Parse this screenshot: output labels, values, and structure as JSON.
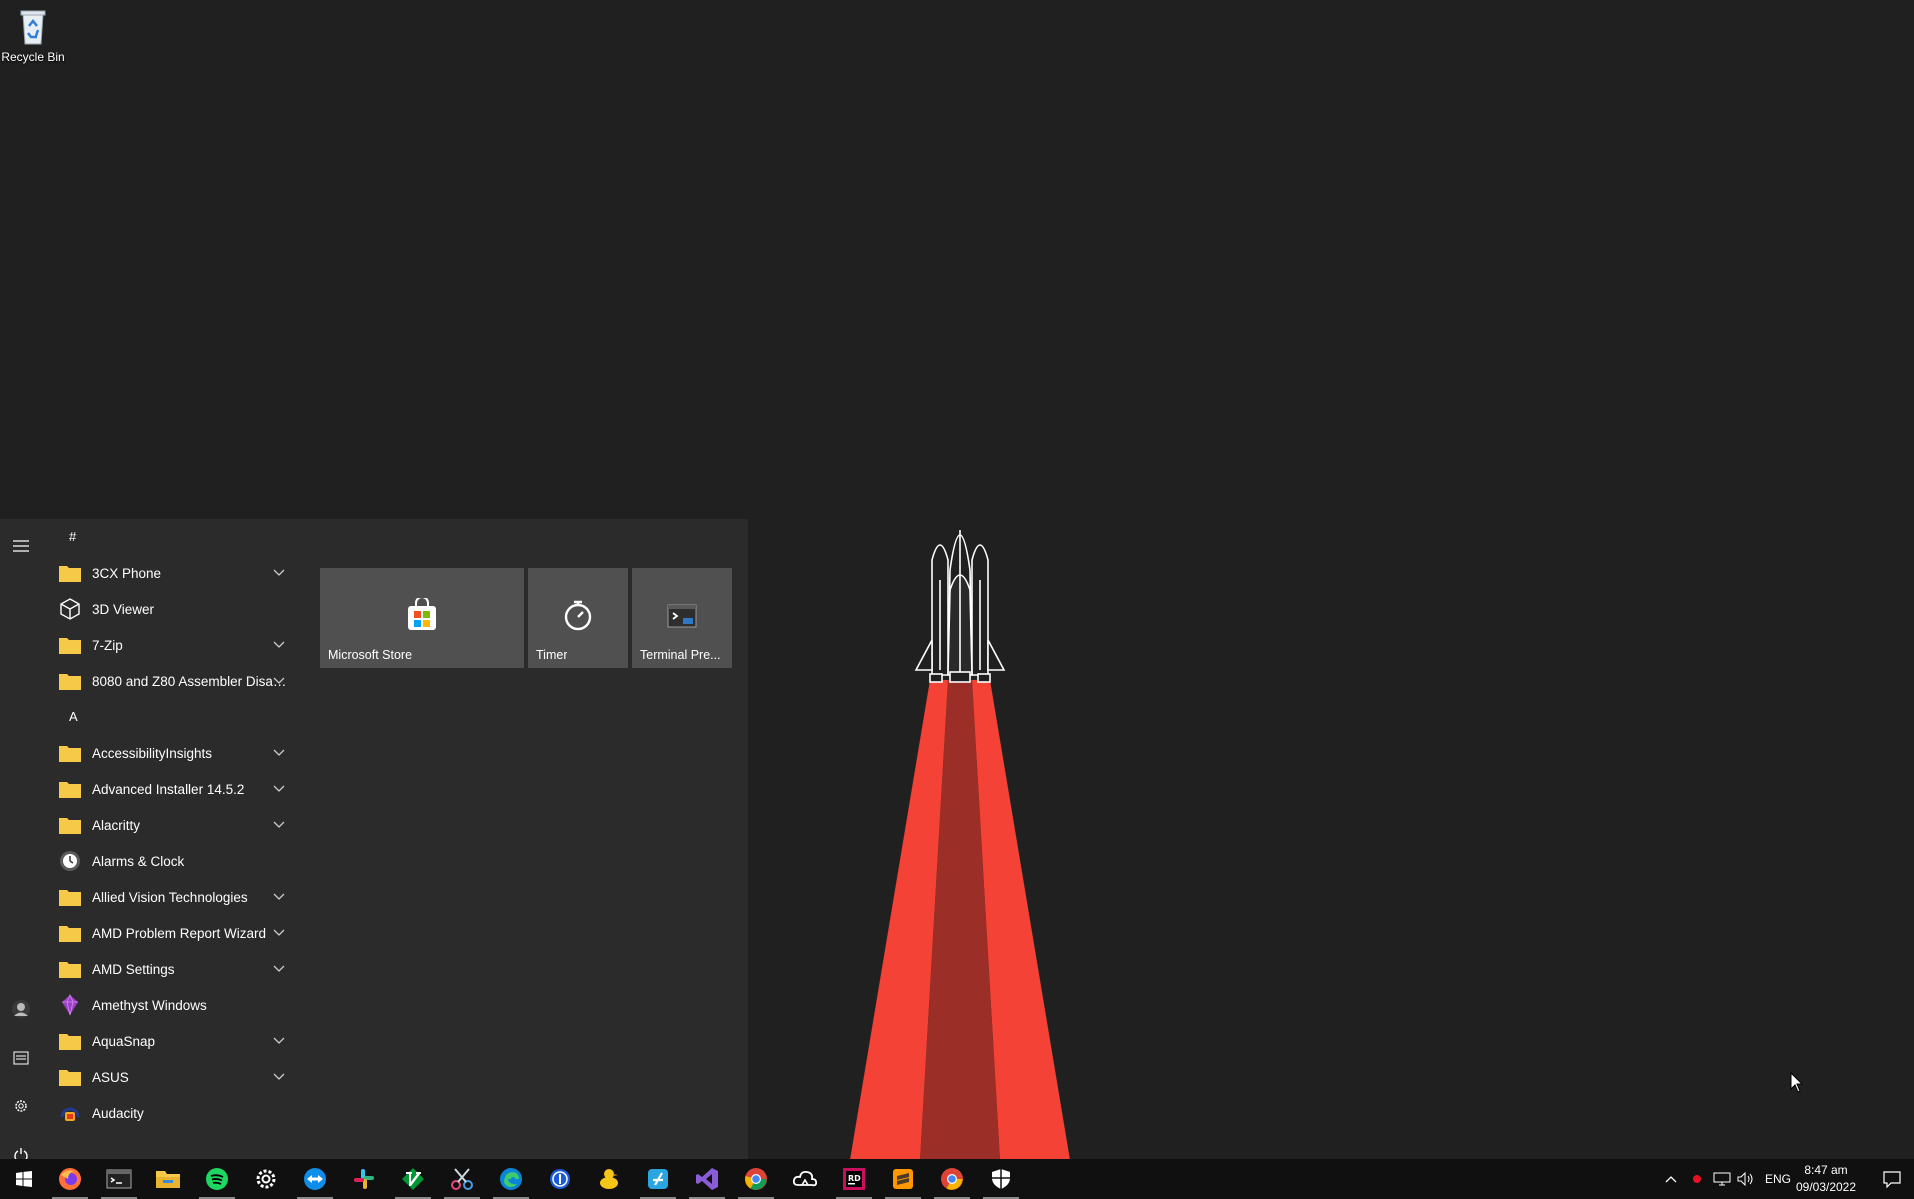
{
  "desktop": {
    "recycle_bin_label": "Recycle Bin"
  },
  "start_menu": {
    "groups": [
      {
        "letter": "#",
        "apps": [
          {
            "name": "3CX Phone",
            "icon": "folder-icon",
            "expandable": true
          },
          {
            "name": "3D Viewer",
            "icon": "cube-icon",
            "expandable": false
          },
          {
            "name": "7-Zip",
            "icon": "folder-icon",
            "expandable": true
          },
          {
            "name": "8080 and Z80 Assembler Disas...",
            "icon": "folder-icon",
            "expandable": true
          }
        ]
      },
      {
        "letter": "A",
        "apps": [
          {
            "name": "AccessibilityInsights",
            "icon": "folder-icon",
            "expandable": true
          },
          {
            "name": "Advanced Installer 14.5.2",
            "icon": "folder-icon",
            "expandable": true
          },
          {
            "name": "Alacritty",
            "icon": "folder-icon",
            "expandable": true
          },
          {
            "name": "Alarms & Clock",
            "icon": "clock-icon",
            "expandable": false
          },
          {
            "name": "Allied Vision Technologies",
            "icon": "folder-icon",
            "expandable": true
          },
          {
            "name": "AMD Problem Report Wizard",
            "icon": "folder-icon",
            "expandable": true
          },
          {
            "name": "AMD Settings",
            "icon": "folder-icon",
            "expandable": true
          },
          {
            "name": "Amethyst Windows",
            "icon": "amethyst-icon",
            "expandable": false
          },
          {
            "name": "AquaSnap",
            "icon": "folder-icon",
            "expandable": true
          },
          {
            "name": "ASUS",
            "icon": "folder-icon",
            "expandable": true
          },
          {
            "name": "Audacity",
            "icon": "audacity-icon",
            "expandable": false
          }
        ]
      }
    ],
    "tiles": [
      {
        "label": "Microsoft Store",
        "icon": "store-icon"
      },
      {
        "label": "Timer",
        "icon": "timer-icon"
      },
      {
        "label": "Terminal Pre...",
        "icon": "terminal-icon"
      }
    ]
  },
  "taskbar": {
    "apps": [
      "firefox-icon",
      "terminal-icon",
      "file-explorer-icon",
      "spotify-icon",
      "settings-icon",
      "teamviewer-icon",
      "slack-icon",
      "vim-icon",
      "snipping-tool-icon",
      "edge-icon",
      "1password-icon",
      "cyberduck-icon",
      "fiddler-icon",
      "visual-studio-icon",
      "chrome-icon",
      "cloud-icon",
      "rider-icon",
      "sublime-icon",
      "chrome-canary-icon",
      "defender-icon"
    ],
    "language": "ENG",
    "time": "8:47 am",
    "date": "09/03/2022"
  },
  "colors": {
    "desktop_bg": "#202020",
    "start_bg": "#2b2b2b",
    "tile_bg": "#505050",
    "taskbar_bg": "#101010",
    "flame": "#f44336",
    "folder": "#f7c948"
  }
}
